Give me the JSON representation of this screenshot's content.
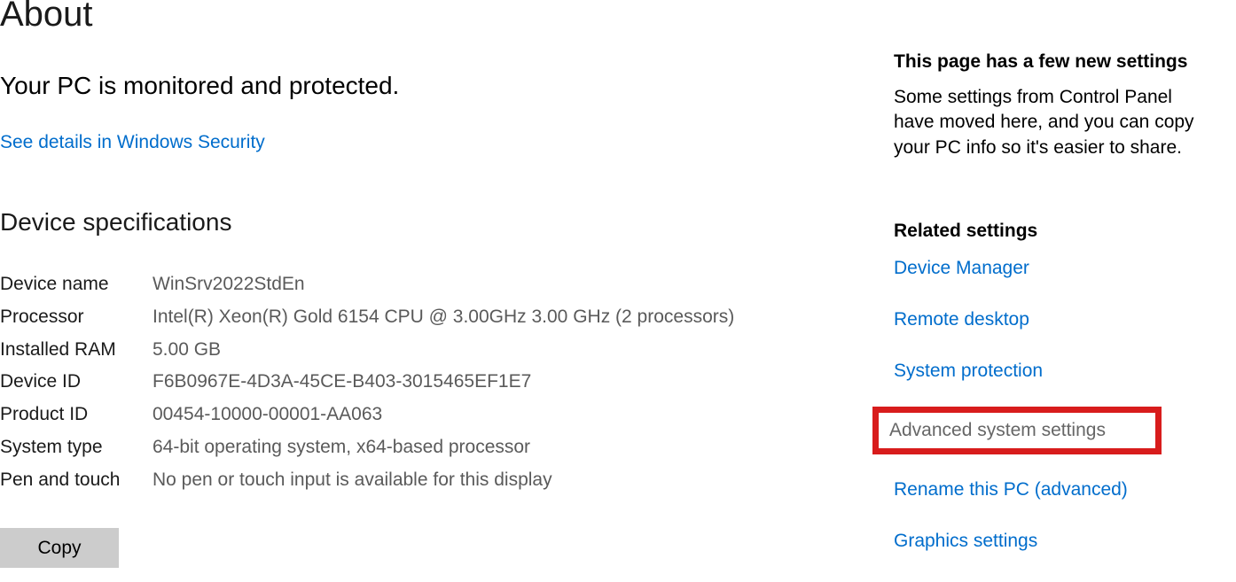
{
  "page_title": "About",
  "status_line": "Your PC is monitored and protected.",
  "security_link": "See details in Windows Security",
  "device_specs": {
    "title": "Device specifications",
    "rows": [
      {
        "label": "Device name",
        "value": "WinSrv2022StdEn"
      },
      {
        "label": "Processor",
        "value": "Intel(R) Xeon(R) Gold 6154 CPU @ 3.00GHz   3.00 GHz (2 processors)"
      },
      {
        "label": "Installed RAM",
        "value": "5.00 GB"
      },
      {
        "label": "Device ID",
        "value": "F6B0967E-4D3A-45CE-B403-3015465EF1E7"
      },
      {
        "label": "Product ID",
        "value": "00454-10000-00001-AA063"
      },
      {
        "label": "System type",
        "value": "64-bit operating system, x64-based processor"
      },
      {
        "label": "Pen and touch",
        "value": "No pen or touch input is available for this display"
      }
    ],
    "copy_button": "Copy"
  },
  "sidebar": {
    "info_heading": "This page has a few new settings",
    "info_text": "Some settings from Control Panel have moved here, and you can copy your PC info so it's easier to share.",
    "related_heading": "Related settings",
    "links": {
      "device_manager": "Device Manager",
      "remote_desktop": "Remote desktop",
      "system_protection": "System protection",
      "advanced_system_settings": "Advanced system settings",
      "rename_pc": "Rename this PC (advanced)",
      "graphics_settings": "Graphics settings"
    }
  }
}
